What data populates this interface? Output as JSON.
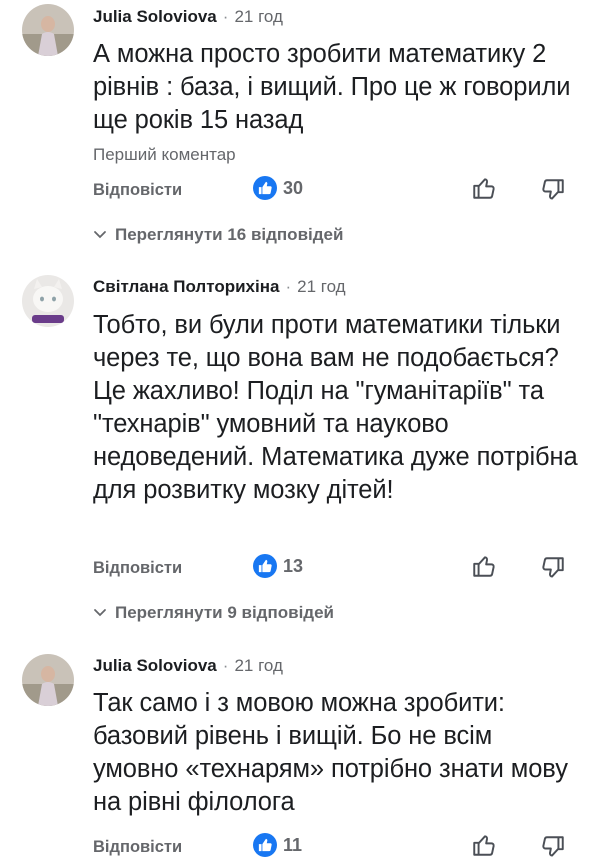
{
  "comments": [
    {
      "author": "Julia Soloviova",
      "separator": "·",
      "time": "21 год",
      "text": "А можна просто зробити математику 2 рівнів : база, і вищий. Про це ж говорили ще років 15 назад",
      "badge": "Перший коментар",
      "reply_label": "Відповісти",
      "like_count": "30",
      "view_replies": "Переглянути 16 відповідей"
    },
    {
      "author": "Світлана Полторихіна",
      "separator": "·",
      "time": "21 год",
      "text": "Тобто, ви були проти математики тільки через те, що вона вам не подобається? Це жахливо! Поділ на \"гуманітаріїв\" та \"технарів\" умовний та науково недоведений. Математика дуже потрібна для розвитку мозку дітей!",
      "reply_label": "Відповісти",
      "like_count": "13",
      "view_replies": "Переглянути 9 відповідей"
    },
    {
      "author": "Julia Soloviova",
      "separator": "·",
      "time": "21 год",
      "text": "Так само і з мовою можна зробити: базовий рівень і вищій. Бо не всім умовно «технарям» потрібно знати мову на рівні філолога",
      "reply_label": "Відповісти",
      "like_count": "11"
    }
  ],
  "icons": {
    "like_badge": "thumbs-up-icon",
    "like": "thumbs-up-outline-icon",
    "dislike": "thumbs-down-outline-icon",
    "expand": "chevron-down-icon"
  },
  "colors": {
    "accent": "#1877f2",
    "muted_text": "#65676b",
    "text": "#1c1e21"
  }
}
